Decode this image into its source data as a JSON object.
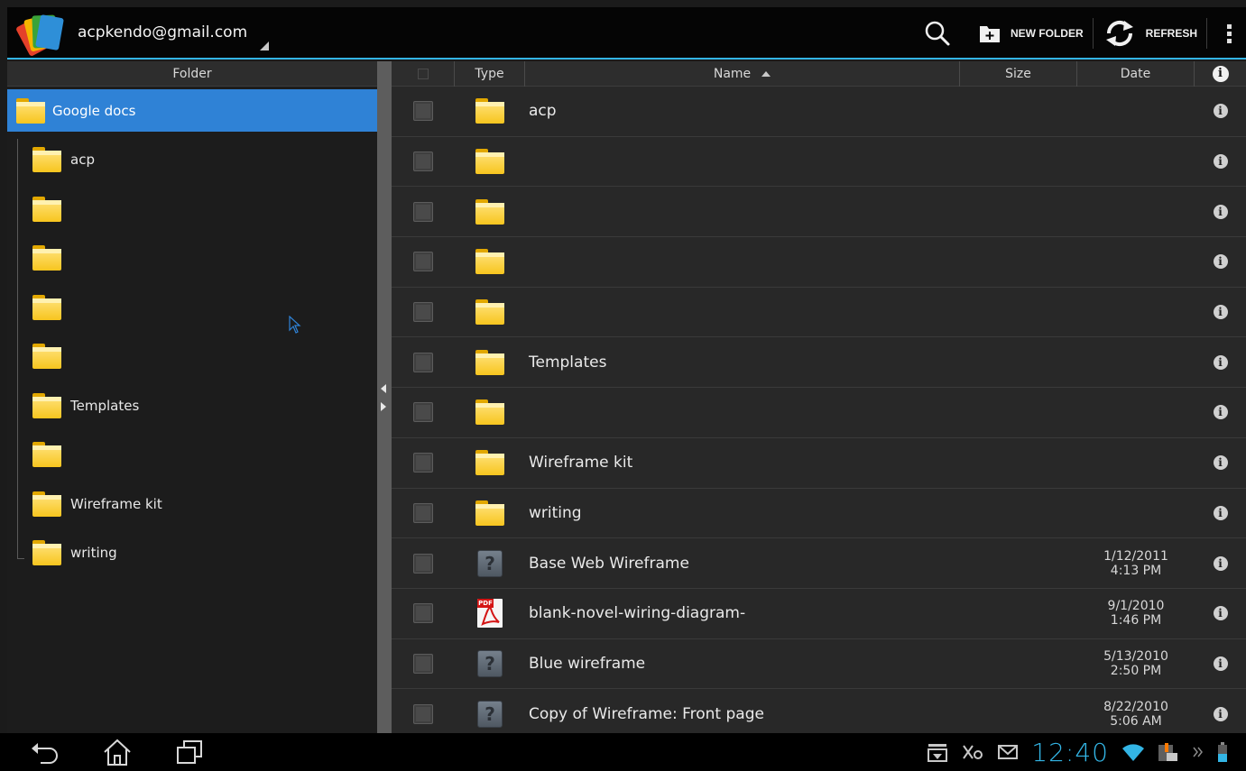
{
  "app": {
    "account": "acpkendo@gmail.com",
    "accent_color": "#33b5e5",
    "selected_color": "#2f82d6"
  },
  "actions": {
    "search_icon": "search-icon",
    "new_folder_label": "NEW FOLDER",
    "refresh_label": "REFRESH",
    "overflow_icon": "overflow-menu-icon"
  },
  "left_pane": {
    "header": "Folder",
    "root": {
      "label": "Google docs",
      "icon": "folder-icon",
      "selected": true
    },
    "items": [
      {
        "label": "acp",
        "icon": "folder-icon"
      },
      {
        "label": "",
        "icon": "folder-icon"
      },
      {
        "label": "",
        "icon": "folder-icon"
      },
      {
        "label": "",
        "icon": "folder-icon"
      },
      {
        "label": "",
        "icon": "folder-icon"
      },
      {
        "label": "Templates",
        "icon": "folder-icon"
      },
      {
        "label": "",
        "icon": "folder-icon"
      },
      {
        "label": "Wireframe kit",
        "icon": "folder-icon"
      },
      {
        "label": "writing",
        "icon": "folder-icon"
      }
    ]
  },
  "grid": {
    "columns": {
      "type": "Type",
      "name": "Name",
      "size": "Size",
      "date": "Date"
    },
    "sort": {
      "column": "Name",
      "direction": "ascending"
    },
    "rows": [
      {
        "type": "folder",
        "name": "acp",
        "size": "",
        "date": "",
        "time": ""
      },
      {
        "type": "folder",
        "name": "",
        "size": "",
        "date": "",
        "time": ""
      },
      {
        "type": "folder",
        "name": "",
        "size": "",
        "date": "",
        "time": ""
      },
      {
        "type": "folder",
        "name": "",
        "size": "",
        "date": "",
        "time": ""
      },
      {
        "type": "folder",
        "name": "",
        "size": "",
        "date": "",
        "time": ""
      },
      {
        "type": "folder",
        "name": "Templates",
        "size": "",
        "date": "",
        "time": ""
      },
      {
        "type": "folder",
        "name": "",
        "size": "",
        "date": "",
        "time": ""
      },
      {
        "type": "folder",
        "name": "Wireframe kit",
        "size": "",
        "date": "",
        "time": ""
      },
      {
        "type": "folder",
        "name": "writing",
        "size": "",
        "date": "",
        "time": ""
      },
      {
        "type": "unknown",
        "name": "Base Web Wireframe",
        "size": "",
        "date": "1/12/2011",
        "time": "4:13 PM"
      },
      {
        "type": "pdf",
        "name": "blank-novel-wiring-diagram-",
        "size": "",
        "date": "9/1/2010",
        "time": "1:46 PM"
      },
      {
        "type": "unknown",
        "name": "Blue wireframe",
        "size": "",
        "date": "5/13/2010",
        "time": "2:50 PM"
      },
      {
        "type": "unknown",
        "name": "Copy of Wireframe: Front page",
        "size": "",
        "date": "8/22/2010",
        "time": "5:06 AM"
      }
    ]
  },
  "system_bar": {
    "clock": "12:40",
    "nav": [
      "back-icon",
      "home-icon",
      "recent-apps-icon"
    ],
    "status_icons": [
      "download-icon",
      "sync-icon",
      "gmail-icon",
      "wifi-icon",
      "keyboard-notification-icon",
      "battery-icon"
    ]
  }
}
